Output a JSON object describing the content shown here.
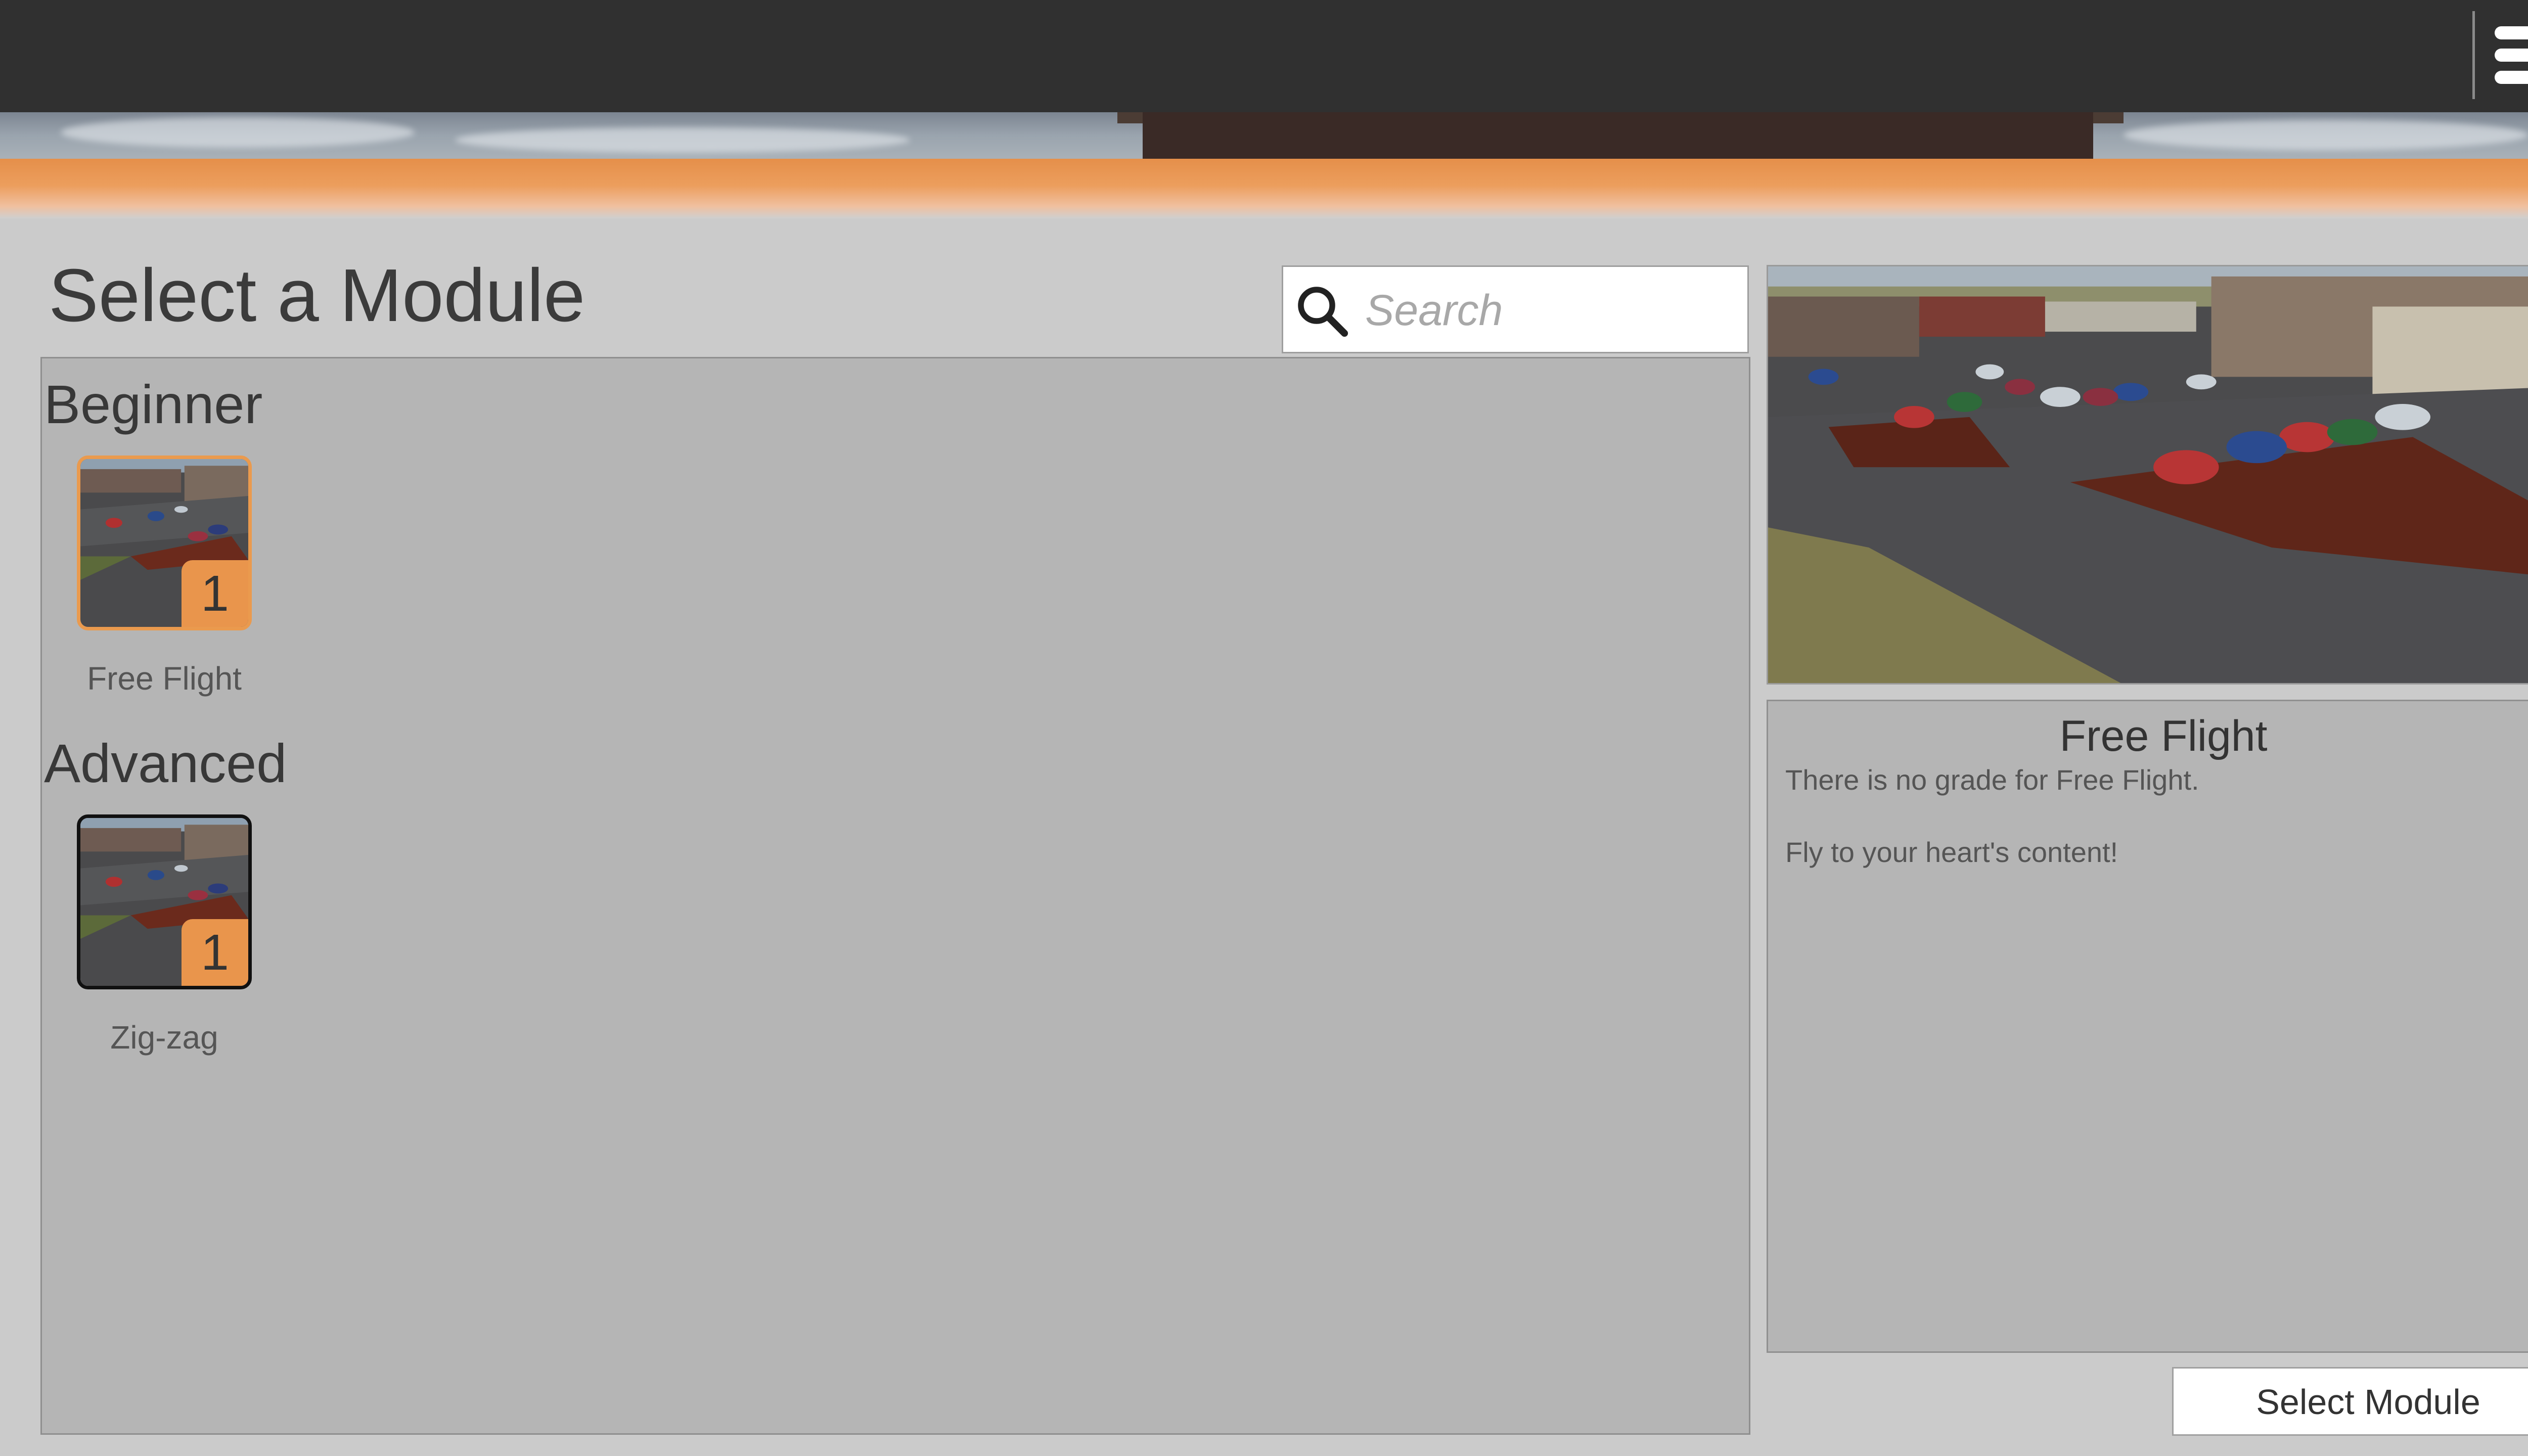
{
  "header": {
    "menu_icon": "hamburger-menu-icon"
  },
  "page": {
    "title": "Select a Module"
  },
  "search": {
    "placeholder": "Search",
    "value": "",
    "icon": "search-icon"
  },
  "sections": [
    {
      "title": "Beginner",
      "modules": [
        {
          "name": "Free Flight",
          "badge": "1",
          "selected": true
        }
      ]
    },
    {
      "title": "Advanced",
      "modules": [
        {
          "name": "Zig-zag",
          "badge": "1",
          "selected": false
        }
      ]
    }
  ],
  "details": {
    "title": "Free Flight",
    "description_line1": "There is no grade for Free Flight.",
    "description_line2": "Fly to your heart's content!"
  },
  "actions": {
    "select_label": "Select Module"
  },
  "colors": {
    "accent": "#e9954c",
    "topbar": "#303030",
    "panel": "#b5b5b5",
    "background": "#cbcbcb"
  }
}
